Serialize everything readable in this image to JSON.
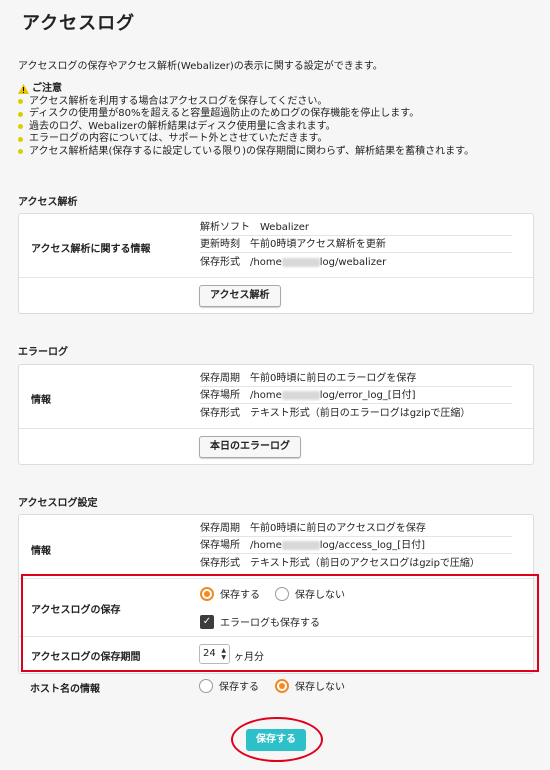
{
  "page": {
    "title": "アクセスログ",
    "description": "アクセスログの保存やアクセス解析(Webalizer)の表示に関する設定ができます。"
  },
  "notice": {
    "title": "ご注意",
    "items": [
      "アクセス解析を利用する場合はアクセスログを保存してください。",
      "ディスクの使用量が80%を超えると容量超過防止のためログの保存機能を停止します。",
      "過去のログ、Webalizerの解析結果はディスク使用量に含まれます。",
      "エラーログの内容については、サポート外とさせていただきます。",
      "アクセス解析結果(保存するに設定している限り)の保存期間に関わらず、解析結果を蓄積されます。"
    ]
  },
  "analysis": {
    "section_title": "アクセス解析",
    "row_label": "アクセス解析に関する情報",
    "lines": [
      {
        "key": "解析ソフト",
        "value": "Webalizer"
      },
      {
        "key": "更新時刻",
        "value": "午前0時頃アクセス解析を更新"
      },
      {
        "key": "保存形式",
        "value_pre": "/home",
        "value_post": "log/webalizer"
      }
    ],
    "button_label": "アクセス解析"
  },
  "error_log": {
    "section_title": "エラーログ",
    "row_label": "情報",
    "lines": [
      {
        "key": "保存周期",
        "value": "午前0時頃に前日のエラーログを保存"
      },
      {
        "key": "保存場所",
        "value_pre": "/home",
        "value_post": "log/error_log_[日付]"
      },
      {
        "key": "保存形式",
        "value": "テキスト形式（前日のエラーログはgzipで圧縮）"
      }
    ],
    "button_label": "本日のエラーログ"
  },
  "access_log_settings": {
    "section_title": "アクセスログ設定",
    "info_label": "情報",
    "lines": [
      {
        "key": "保存周期",
        "value": "午前0時頃に前日のアクセスログを保存"
      },
      {
        "key": "保存場所",
        "value_pre": "/home",
        "value_post": "log/access_log_[日付]"
      },
      {
        "key": "保存形式",
        "value": "テキスト形式（前日のアクセスログはgzipで圧縮）"
      }
    ],
    "save_label": "アクセスログの保存",
    "save_options": {
      "yes": "保存する",
      "no": "保存しない",
      "selected": "yes"
    },
    "save_error_log_label": "エラーログも保存する",
    "save_error_log_checked": true,
    "period_label": "アクセスログの保存期間",
    "period_value": "24",
    "period_unit": "ヶ月分",
    "hostname_label": "ホスト名の情報",
    "hostname_options": {
      "yes": "保存する",
      "no": "保存しない",
      "selected": "no"
    }
  },
  "footer": {
    "save_button": "保存する"
  },
  "colors": {
    "accent_orange": "#f08a24",
    "save_button": "#2ec0c9",
    "highlight_red": "#e0001b",
    "notice_dot": "#d9d000"
  }
}
